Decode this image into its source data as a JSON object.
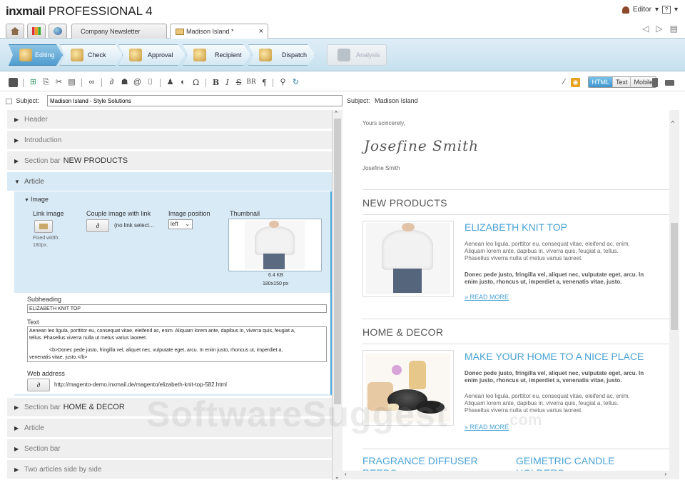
{
  "app": {
    "brand": "inxmail",
    "product": "PROFESSIONAL 4",
    "user": "Editor",
    "help": "?"
  },
  "tabs": [
    {
      "label": "Company Newsletter"
    },
    {
      "label": "Madison Island *",
      "close": "×"
    }
  ],
  "workflow": [
    {
      "label": "Editing",
      "state": "active"
    },
    {
      "label": "Check",
      "state": "normal"
    },
    {
      "label": "Approval",
      "state": "normal"
    },
    {
      "label": "Recipient",
      "state": "normal"
    },
    {
      "label": "Dispatch",
      "state": "normal"
    },
    {
      "label": "Analysis",
      "state": "disabled"
    }
  ],
  "toolbar": {
    "bold": "B",
    "italic": "I",
    "strike": "S",
    "br": "BR",
    "para": "¶",
    "omega": "Ω",
    "views": [
      "HTML",
      "Text",
      "Mobile"
    ],
    "active_view": "HTML"
  },
  "subject": {
    "label": "Subject:",
    "value": "Madison Island - Style Solutions",
    "preview_label": "Subject:",
    "preview_value": "Madison Island"
  },
  "sections": {
    "header": "Header",
    "introduction": "Introduction",
    "section_bar": "Section bar",
    "section_bar_1_value": "NEW PRODUCTS",
    "article": "Article",
    "section_bar_2_value": "HOME & DECOR",
    "article_2": "Article",
    "section_bar_3": "Section bar",
    "two_articles": "Two articles side by side"
  },
  "image_block": {
    "title": "Image",
    "link_image": "Link image",
    "fixed_width": "Fixed width:",
    "fixed_width_value": "180px.",
    "couple_label": "Couple image with link",
    "couple_value": "(no link select...",
    "position_label": "Image position",
    "position_value": "left",
    "thumbnail_label": "Thumbnail",
    "file_size": "6.4 KB",
    "dimensions": "180x150 px"
  },
  "article_fields": {
    "subheading_label": "Subheading",
    "subheading_value": "ELIZABETH KNIT TOP",
    "text_label": "Text",
    "text_value_1": "Aenean leo ligula, porttitor eu, consequat vitae, eleifend ac, enim. Aliquam lorem ante, dapibus in, viverra quis, feugiat a,",
    "text_value_2": "tellus. Phasellus viverra nulla ut metus varius laoreet.",
    "text_value_3": "<b>Donec pede justo, fringilla vel, aliquet nec, vulputate eget, arcu. In enim justo, rhoncus ut, imperdiet a,",
    "text_value_4": "venenatis vitae, justo.</b>",
    "web_label": "Web address",
    "web_value": "http://magento-demo.inxmail.de/magento/elizabeth-knit-top-582.html"
  },
  "preview": {
    "closing": "Yours scincerely,",
    "signature": "Josefine Smith",
    "signer": "Josefine Smith",
    "section1": "NEW PRODUCTS",
    "product1_title": "ELIZABETH KNIT TOP",
    "product1_text1": "Aenean leo ligula, porttitor eu, consequat vitae, eleifend ac, enim.",
    "product1_text2": "Aliquam lorem ante, dapibus in, viverra quis, feugiat a, tellus.",
    "product1_text3": "Phasellus viverra nulla ut metus varius laoreet.",
    "product1_bold1": "Donec pede justo, fringilla vel, aliquet nec, vulputate eget, arcu. In",
    "product1_bold2": "enim justo, rhoncus ut, imperdiet a, venenatis vitae, justo.",
    "read_more_1": "» READ MORE",
    "section2": "HOME & DECOR",
    "product2_title": "MAKE YOUR HOME TO A NICE PLACE",
    "product2_bold1": "Donec pede justo, fringilla vel, aliquet nec, vulputate eget, arcu. In",
    "product2_bold2": "enim justo, rhoncus ut, imperdiet a, venenatis vitae, justo.",
    "product2_text1": "Aenean leo ligula, porttitor eu, consequat vitae, eleifend ac, enim.",
    "product2_text2": "Aliquam lorem ante, dapibus in, viverra quis, feugiat a, tellus.",
    "product2_text3": "Phasellus viverra nulla ut metus varius laoreet.",
    "read_more_2": "» READ MORE",
    "product3_title": "FRAGRANCE DIFFUSER",
    "product3_title_cont": "REEDS",
    "product4_title": "GEIMETRIC CANDLE",
    "product4_title_cont": "HOLDERS"
  },
  "watermark": {
    "text": "SoftwareSuggest",
    "suffix": ".com"
  }
}
